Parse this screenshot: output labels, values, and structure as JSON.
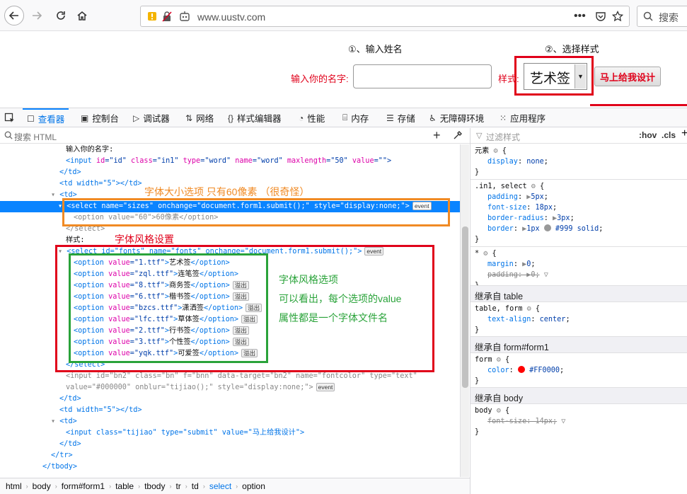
{
  "browser": {
    "url": "www.uustv.com",
    "search_placeholder": "搜索"
  },
  "page": {
    "step1": "①、输入姓名",
    "step2": "②、选择样式",
    "name_label": "输入你的名字:",
    "style_label": "样式:",
    "selected_style": "艺术签",
    "submit_label": "马上给我设计"
  },
  "devtools": {
    "tabs": [
      "查看器",
      "控制台",
      "调试器",
      "网络",
      "样式编辑器",
      "性能",
      "内存",
      "存储",
      "无障碍环境",
      "应用程序"
    ],
    "search_placeholder": "搜索 HTML",
    "filter_placeholder": "过滤样式",
    "hov": ":hov",
    "cls": ".cls",
    "breadcrumb": [
      "html",
      "body",
      "form#form1",
      "table",
      "tbody",
      "tr",
      "td",
      "select",
      "option"
    ]
  },
  "html_lines": {
    "l0": "输入你的名字:",
    "l1_a": "<input ",
    "l1_b": "id",
    "l1_c": "=\"id\" ",
    "l1_d": "class",
    "l1_e": "=\"in1\" ",
    "l1_f": "type",
    "l1_g": "=\"word\" ",
    "l1_h": "name",
    "l1_i": "=\"word\" ",
    "l1_j": "maxlength",
    "l1_k": "=\"50\" ",
    "l1_l": "value",
    "l1_m": "=\"\">",
    "l2": "</td>",
    "l3": "<td width=\"5\"></td>",
    "l4": "<td>",
    "l5": "<select name=\"sizes\" onchange=\"document.form1.submit();\" style=\"display:none;\">",
    "l6": "<option value=\"60\">60像素</option>",
    "l7": "</select>",
    "l8": "样式:",
    "l9": "<select id=\"fonts\" name=\"fonts\" onchange=\"document.form1.submit();\">",
    "options": [
      {
        "value": "1.ttf",
        "label": "艺术签",
        "badge": ""
      },
      {
        "value": "zql.ttf",
        "label": "连笔签",
        "badge": ""
      },
      {
        "value": "8.ttf",
        "label": "商务签",
        "badge": "溢出"
      },
      {
        "value": "6.ttf",
        "label": "楷书签",
        "badge": "溢出"
      },
      {
        "value": "bzcs.ttf",
        "label": "潇洒签",
        "badge": "溢出"
      },
      {
        "value": "lfc.ttf",
        "label": "草体签",
        "badge": "溢出"
      },
      {
        "value": "2.ttf",
        "label": "行书签",
        "badge": "溢出"
      },
      {
        "value": "3.ttf",
        "label": "个性签",
        "badge": "溢出"
      },
      {
        "value": "yqk.ttf",
        "label": "可爱签",
        "badge": "溢出"
      }
    ],
    "l19": "</select>",
    "l20": "<input id=\"bn2\" class=\"bn\" f=\"bnn\" data-target=\"bn2\" name=\"fontcolor\" type=\"text\"",
    "l21": "value=\"#000000\" onblur=\"tijiao();\" style=\"display:none;\">",
    "l22": "</td>",
    "l23": "<td width=\"5\"></td>",
    "l24": "<td>",
    "l25": "<input class=\"tijiao\" type=\"submit\" value=\"马上给我设计\">",
    "l26": "</td>",
    "l27": "</tr>",
    "l28": "</tbody>",
    "event": "event"
  },
  "annotations": {
    "size_note": "字体大小选项 只有60像素 （很奇怪）",
    "style_note": "字体风格设置",
    "green_1": "字体风格选项",
    "green_2": "可以看出，每个选项的value",
    "green_3": "属性都是一个字体文件名"
  },
  "rules": {
    "r1_sel": "元素",
    "r1_p": "display",
    "r1_v": "none",
    "r2_sel": ".in1, select",
    "r2_padding": "5px",
    "r2_fontsize": "18px",
    "r2_radius": "3px",
    "r2_border_a": "1px",
    "r2_border_b": "#999 solid",
    "r3_sel": "*",
    "r3_margin": "0",
    "r3_padding": "0",
    "inh_table": "继承自 table",
    "r4_sel": "table, form",
    "r4_v": "center",
    "inh_form": "继承自 form#form1",
    "r5_sel": "form",
    "r5_v": "#FF0000",
    "inh_body": "继承自 body",
    "r6_sel": "body",
    "r6_v": "font-size: 14px;"
  },
  "colors": {
    "accent": "#0a84ff",
    "annotation_red": "#e0001a",
    "annotation_orange": "#f08a24",
    "annotation_green": "#2aa33a",
    "form_color": "#FF0000"
  }
}
